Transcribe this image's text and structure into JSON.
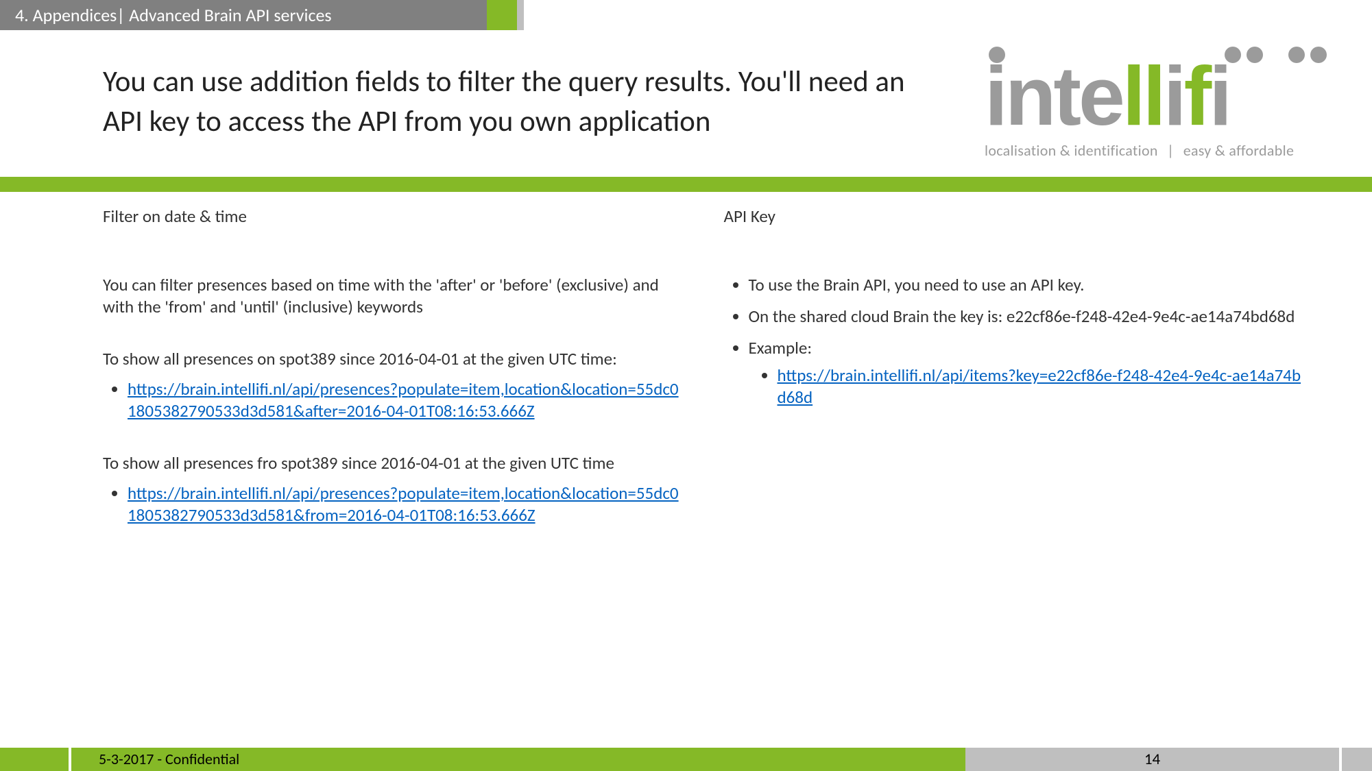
{
  "header": {
    "breadcrumb": "4. Appendices| Advanced Brain API services"
  },
  "title": "You can use addition fields to filter the query results. You'll need an API key to access the API from you own application",
  "logo": {
    "word": "intellifi",
    "tagline_left": "localisation & identification",
    "tagline_sep": "|",
    "tagline_right": "easy & affordable"
  },
  "left": {
    "heading": "Filter on date & time",
    "p1": "You can filter presences based on time with the 'after' or 'before' (exclusive) and with the 'from' and 'until' (inclusive) keywords",
    "p2": "To show all presences on spot389 since 2016-04-01 at the given UTC time:",
    "link1": "https://brain.intellifi.nl/api/presences?populate=item,location&location=55dc01805382790533d3d581&after=2016-04-01T08:16:53.666Z",
    "p3": "To show all presences fro spot389 since 2016-04-01 at the given UTC time",
    "link2": "https://brain.intellifi.nl/api/presences?populate=item,location&location=55dc01805382790533d3d581&from=2016-04-01T08:16:53.666Z"
  },
  "right": {
    "heading": "API Key",
    "b1": "To use the Brain API, you need to use an API key.",
    "b2": "On the shared cloud Brain the key is: e22cf86e-f248-42e4-9e4c-ae14a74bd68d",
    "b3": "Example:",
    "example_link": "https://brain.intellifi.nl/api/items?key=e22cf86e-f248-42e4-9e4c-ae14a74bd68d"
  },
  "footer": {
    "left": "5-3-2017 - Confidential",
    "page": "14"
  }
}
